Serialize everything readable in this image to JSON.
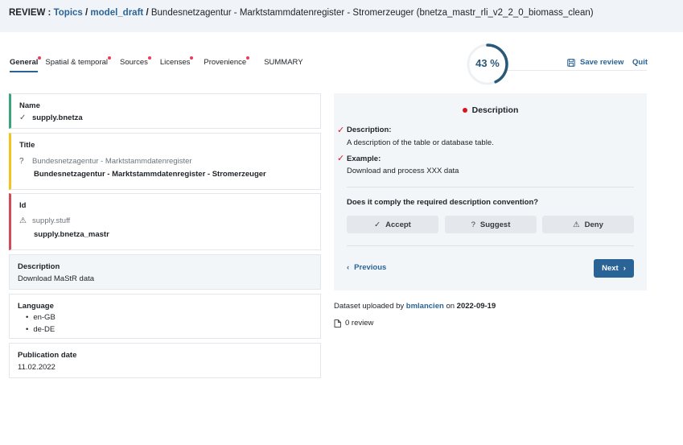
{
  "header": {
    "review_label": "REVIEW :",
    "crumb_topics": "Topics",
    "sep1": "/",
    "crumb_draft": "model_draft",
    "sep2": "/",
    "crumb_table": "Bundesnetzagentur - Marktstammdatenregister - Stromerzeuger (bnetza_mastr_rli_v2_2_0_biomass_clean)"
  },
  "tabs": [
    {
      "label": "General",
      "active": true,
      "dot": true
    },
    {
      "label": "Spatial & temporal",
      "active": false,
      "dot": true
    },
    {
      "label": "Sources",
      "active": false,
      "dot": true
    },
    {
      "label": "Licenses",
      "active": false,
      "dot": true
    },
    {
      "label": "Provenience",
      "active": false,
      "dot": true
    },
    {
      "label": "SUMMARY",
      "active": false,
      "dot": false
    }
  ],
  "progress": {
    "percent": 43,
    "label": "43 %",
    "color": "#2a5878"
  },
  "actions": {
    "save_label": "Save review",
    "quit_label": "Quit"
  },
  "fields": {
    "name": {
      "label": "Name",
      "value": "supply.bnetza"
    },
    "title": {
      "label": "Title",
      "original": "Bundesnetzagentur - Marktstammdatenregister",
      "suggested": "Bundesnetzagentur - Marktstammdatenregister - Stromerzeuger"
    },
    "id": {
      "label": "Id",
      "original": "supply.stuff",
      "suggested": "supply.bnetza_mastr"
    },
    "description": {
      "label": "Description",
      "value": "Download MaStR data"
    },
    "language": {
      "label": "Language",
      "items": [
        "en-GB",
        "de-DE"
      ]
    },
    "publication_date": {
      "label": "Publication date",
      "value": "11.02.2022"
    }
  },
  "panel": {
    "title": "Description",
    "desc_heading": "Description:",
    "desc_text": "A description of the table or database table.",
    "example_heading": "Example:",
    "example_text": "Download and process XXX data",
    "question": "Does it comply the required description convention?",
    "accept_label": "Accept",
    "suggest_label": "Suggest",
    "deny_label": "Deny",
    "previous_label": "Previous",
    "next_label": "Next"
  },
  "meta": {
    "uploaded_prefix": "Dataset uploaded by",
    "user": "bmlancien",
    "on_word": "on",
    "date": "2022-09-19",
    "reviews": "0 review"
  },
  "colors": {
    "accent": "#2a6496",
    "ok": "#3aa57c",
    "warn": "#f2c31f",
    "error": "#d24b57",
    "tab_dot": "#e83e5a"
  }
}
